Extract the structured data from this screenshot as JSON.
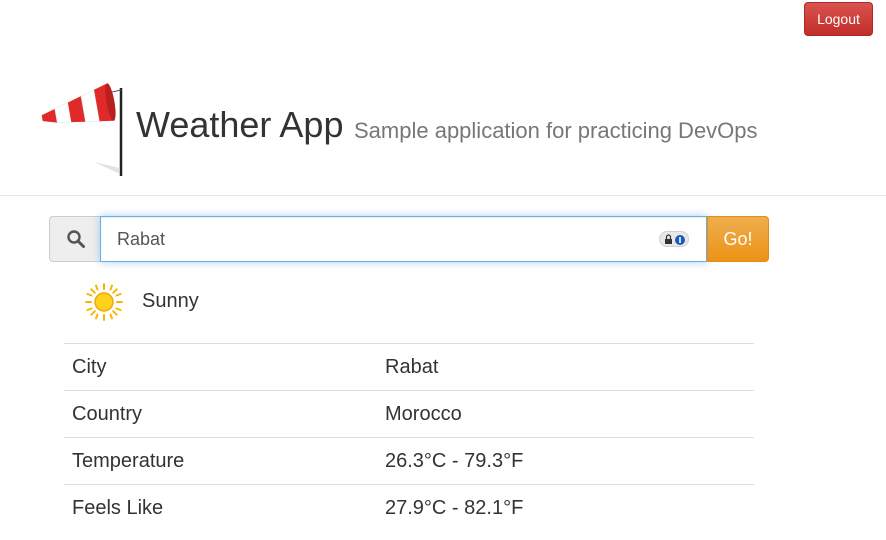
{
  "topbar": {
    "logout_label": "Logout",
    "logout_color": "#d2322d"
  },
  "header": {
    "title": "Weather App",
    "subtitle": "Sample application for practicing DevOps",
    "logo_icon": "windsock-icon"
  },
  "search": {
    "icon": "search-icon",
    "value": "Rabat",
    "go_label": "Go!",
    "go_color": "#f0ad4e"
  },
  "condition": {
    "icon": "sun-icon",
    "label": "Sunny"
  },
  "details": {
    "rows": [
      {
        "label": "City",
        "value": "Rabat"
      },
      {
        "label": "Country",
        "value": "Morocco"
      },
      {
        "label": "Temperature",
        "value": "26.3°C - 79.3°F"
      },
      {
        "label": "Feels Like",
        "value": "27.9°C - 82.1°F"
      }
    ]
  }
}
